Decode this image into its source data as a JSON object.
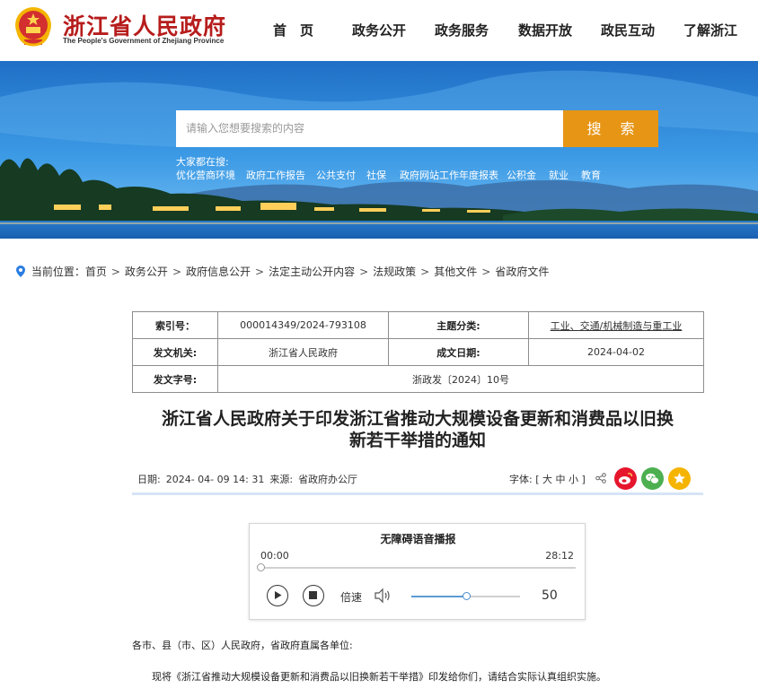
{
  "header": {
    "site_name": "浙江省人民政府",
    "site_subtitle": "The People's Government of Zhejiang Province",
    "nav": [
      "首　页",
      "政务公开",
      "政务服务",
      "数据开放",
      "政民互动",
      "了解浙江"
    ]
  },
  "banner": {
    "search_placeholder": "请输入您想要搜索的内容",
    "search_button": "搜 索",
    "hot_label": "大家都在搜:",
    "hot_links": [
      "优化营商环境",
      "政府工作报告",
      "公共支付",
      "社保",
      "政府网站工作年度报表",
      "公积金",
      "就业",
      "教育"
    ]
  },
  "breadcrumb": {
    "prefix": "当前位置：",
    "items": [
      "首页",
      "政务公开",
      "政府信息公开",
      "法定主动公开内容",
      "法规政策",
      "其他文件",
      "省政府文件"
    ]
  },
  "info_table": {
    "index_label": "索引号：",
    "index_value": "000014349/2024-793108",
    "topic_label": "主题分类:",
    "topic_value": "工业、交通/机械制造与重工业",
    "issuer_label": "发文机关:",
    "issuer_value": "浙江省人民政府",
    "date_label": "成文日期:",
    "date_value": "2024-04-02",
    "docno_label": "发文字号:",
    "docno_value": "浙政发〔2024〕10号"
  },
  "document": {
    "title_line1": "浙江省人民政府关于印发浙江省推动大规模设备更新和消费品以旧换",
    "title_line2": "新若干举措的通知",
    "date_label": "日期:",
    "date_value": "2024- 04- 09 14: 31",
    "source_label": "来源:",
    "source_value": "省政府办公厅",
    "font_label": "字体:",
    "font_sizes": "[ 大 中 小 ]",
    "salutation": "各市、县（市、区）人民政府，省政府直属各单位:",
    "paragraph_1": "现将《浙江省推动大规模设备更新和消费品以旧换新若干举措》印发给你们，请结合实际认真组织实施。"
  },
  "player": {
    "title": "无障碍语音播报",
    "time_current": "00:00",
    "time_total": "28:12",
    "progress": 0,
    "speed_label": "倍速",
    "volume": 50
  },
  "colors": {
    "brand_red": "#b71c1c",
    "search_orange": "#e79515",
    "weibo": "#e6162d",
    "wechat": "#4caf50",
    "favorite": "#f4b400"
  },
  "icons": [
    "emblem-icon",
    "location-pin-icon",
    "share-icon",
    "weibo-icon",
    "wechat-icon",
    "star-icon",
    "play-icon",
    "stop-icon",
    "volume-icon"
  ]
}
